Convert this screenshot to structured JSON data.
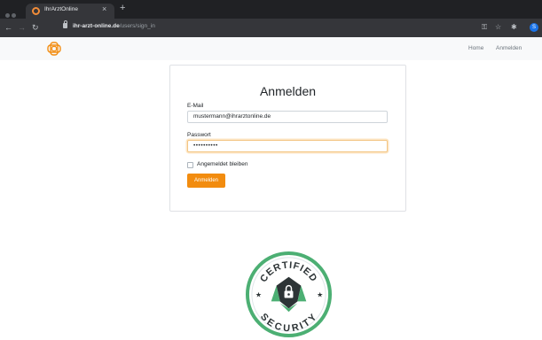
{
  "browser": {
    "tab_title": "IhrArztOnline",
    "tab_close": "×",
    "new_tab": "+",
    "url_host": "ihr-arzt-online.de",
    "url_path": "/users/sign_in",
    "profile_initial": "S"
  },
  "navbar": {
    "links": [
      "Home",
      "Anmelden"
    ]
  },
  "login": {
    "title": "Anmelden",
    "email_label": "E-Mail",
    "email_value": "mustermann@ihrarztonline.de",
    "password_label": "Passwort",
    "password_value": "••••••••••",
    "remember_label": "Angemeldet bleiben",
    "submit_label": "Anmelden"
  },
  "badge": {
    "top_text": "CERTIFIED",
    "bottom_text": "SECURITY"
  },
  "colors": {
    "accent": "#f28c0f",
    "badge_green": "#4caf73",
    "badge_dark": "#2d3436"
  }
}
